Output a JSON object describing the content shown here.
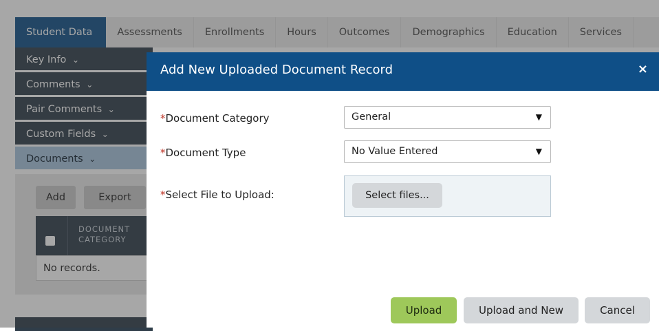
{
  "tabs": [
    {
      "label": "Student Data",
      "active": true
    },
    {
      "label": "Assessments"
    },
    {
      "label": "Enrollments"
    },
    {
      "label": "Hours"
    },
    {
      "label": "Outcomes"
    },
    {
      "label": "Demographics"
    },
    {
      "label": "Education"
    },
    {
      "label": "Services"
    }
  ],
  "sidebar": {
    "items": [
      {
        "label": "Key Info"
      },
      {
        "label": "Comments"
      },
      {
        "label": "Pair Comments"
      },
      {
        "label": "Custom Fields"
      },
      {
        "label": "Documents",
        "active": true
      }
    ],
    "chevron_icon": "chevron-down-icon"
  },
  "documents": {
    "add_label": "Add",
    "export_label": "Export",
    "grid_header": "DOCUMENT CATEGORY",
    "grid_header_line1": "DOCUMENT",
    "grid_header_line2": "CATEGORY",
    "empty_text": "No records."
  },
  "dialog": {
    "title": "Add New Uploaded Document Record",
    "close_glyph": "×",
    "required_mark": "*",
    "fields": {
      "category": {
        "label": "Document Category",
        "value": "General"
      },
      "type": {
        "label": "Document Type",
        "value": "No Value Entered"
      },
      "file": {
        "label": "Select File to Upload:",
        "button_label": "Select files..."
      }
    },
    "dropdown_arrow": "▼",
    "buttons": {
      "upload": "Upload",
      "upload_new": "Upload and New",
      "cancel": "Cancel"
    }
  },
  "colors": {
    "header_blue": "#0f4f87",
    "sidebar_dark": "#2f3d49",
    "sidebar_active": "#a6c4dd",
    "upload_green": "#9ec85a",
    "required_red": "#c0392b"
  }
}
